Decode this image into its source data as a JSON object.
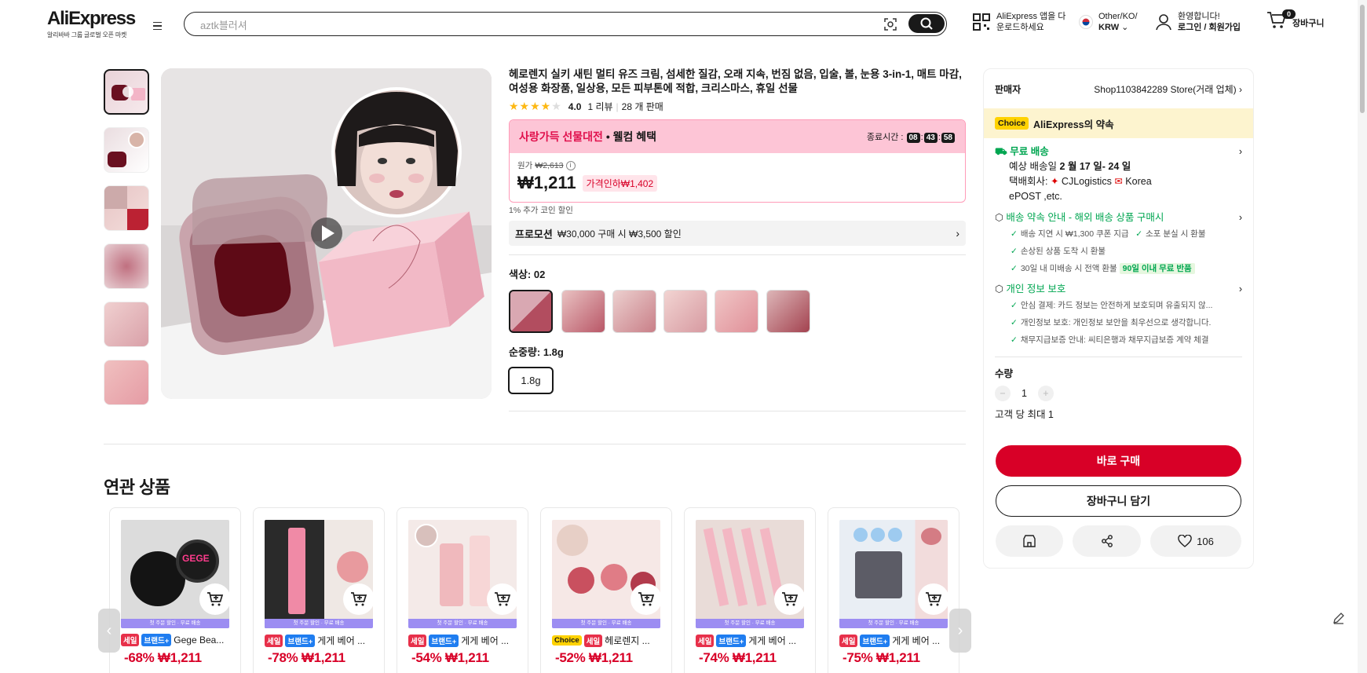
{
  "colors": {
    "accent": "#d80027",
    "choice": "#ffd200",
    "green": "#00a651",
    "promo_pink": "#fdc5d6",
    "sale_tag": "#e7304a",
    "brand_tag": "#1f7df0",
    "band": "#9c8df2"
  },
  "header": {
    "logo": "AliExpress",
    "logo_sub": "알리바바 그룹 글로벌 오픈 마켓",
    "search_placeholder": "aztk블러셔",
    "app_line1": "AliExpress 앱을 다",
    "app_line2": "운로드하세요",
    "lang_line1": "Other/KO/",
    "lang_line2": "KRW",
    "greet": "환영합니다!",
    "login": "로그인 / 회원가입",
    "cart_count": "0",
    "cart_label": "장바구니"
  },
  "product": {
    "title": "헤로렌지 실키 새틴 멀티 유즈 크림, 섬세한 질감, 오래 지속, 번짐 없음, 입술, 볼, 눈용 3-in-1, 매트 마감, 여성용 화장품, 일상용, 모든 피부톤에 적합, 크리스마스, 휴일 선물",
    "rating": "4.0",
    "stars": 4,
    "reviews": "1 리뷰",
    "sold": "28 개 판매",
    "promo_banner": "사랑가득 선물대전",
    "promo_welcome": "• 웰컴 혜택",
    "end_time_label": "종료시간 :",
    "timer": [
      "08",
      "43",
      "58"
    ],
    "original_label": "원가",
    "original_price": "₩2,613",
    "price": "₩1,211",
    "discount_badge": "가격인하₩1,402",
    "coin": "1% 추가 코인 할인",
    "promotion_label": "프로모션",
    "promotion_text": "₩30,000 구매 시 ₩3,500 할인",
    "color_label": "색상: 02",
    "weight_label": "순중량: 1.8g",
    "weight_option": "1.8g"
  },
  "panel": {
    "seller_label": "판매자",
    "seller_name": "Shop1103842289 Store(거래 업체)",
    "choice_tag": "Choice",
    "choice_text": "AliExpress의 약속",
    "free_ship": "무료 배송",
    "eta_prefix": "예상 배송일 ",
    "eta": "2 월 17 일- 24 일",
    "carrier_prefix": "택배회사: ",
    "carrier1": "CJLogistics",
    "carrier2": "Korea",
    "carrier3": "ePOST ,etc.",
    "delivery_title": "배송 약속 안내 - 해외 배송 상품 구매시",
    "delivery_items": [
      "배송 지연 시 ₩1,300 쿠폰 지급",
      "소포 분실 시 환불",
      "손상된 상품 도착 시 환불",
      "30일 내 미배송 시 전액 환불"
    ],
    "return_badge": "90일 이내 무료 반품",
    "privacy_title": "개인 정보 보호",
    "privacy_items": [
      "안심 결제: 카드 정보는 안전하게 보호되며 유출되지 않...",
      "개인정보 보호: 개인정보 보안을 최우선으로 생각합니다.",
      "채무지급보증 안내: 씨티은행과 채무지급보증 계약 체결"
    ],
    "qty_label": "수량",
    "qty": "1",
    "max_label": "고객 당 최대 1",
    "buy_now": "바로 구매",
    "add_cart": "장바구니 담기",
    "likes": "106"
  },
  "related": {
    "title": "연관 상품",
    "band_text": "첫 주문 할인 · 무료 배송",
    "items": [
      {
        "tags": [
          "세일",
          "브랜드+"
        ],
        "name": "Gege Bea...",
        "price": "-68% ₩1,211"
      },
      {
        "tags": [
          "세일",
          "브랜드+"
        ],
        "name": "게게 베어 ...",
        "price": "-78% ₩1,211"
      },
      {
        "tags": [
          "세일",
          "브랜드+"
        ],
        "name": "게게 베어 ...",
        "price": "-54% ₩1,211"
      },
      {
        "tags": [
          "Choice",
          "세일"
        ],
        "name": "헤로렌지 ...",
        "price": "-52% ₩1,211"
      },
      {
        "tags": [
          "세일",
          "브랜드+"
        ],
        "name": "게게 베어 ...",
        "price": "-74% ₩1,211"
      },
      {
        "tags": [
          "세일",
          "브랜드+"
        ],
        "name": "게게 베어 ...",
        "price": "-75% ₩1,211"
      }
    ]
  }
}
